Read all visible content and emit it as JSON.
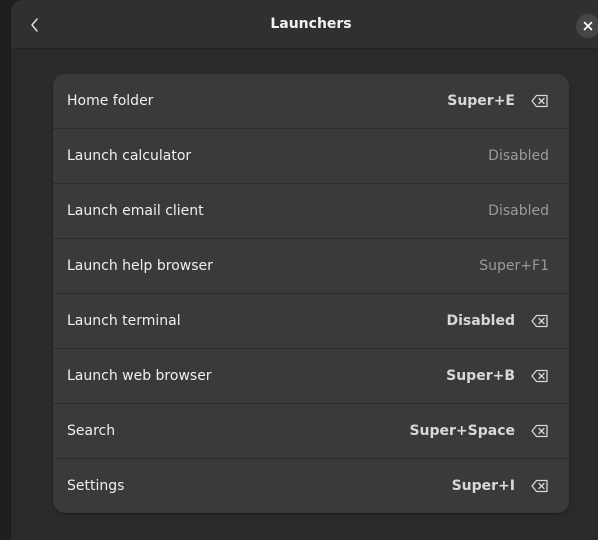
{
  "header": {
    "title": "Launchers",
    "back_icon": "chevron-left-icon",
    "close_icon": "close-icon"
  },
  "shortcuts": [
    {
      "label": "Home folder",
      "accel": "Super+E",
      "custom": true
    },
    {
      "label": "Launch calculator",
      "accel": "Disabled",
      "custom": false
    },
    {
      "label": "Launch email client",
      "accel": "Disabled",
      "custom": false
    },
    {
      "label": "Launch help browser",
      "accel": "Super+F1",
      "custom": false
    },
    {
      "label": "Launch terminal",
      "accel": "Disabled",
      "custom": true
    },
    {
      "label": "Launch web browser",
      "accel": "Super+B",
      "custom": true
    },
    {
      "label": "Search",
      "accel": "Super+Space",
      "custom": true
    },
    {
      "label": "Settings",
      "accel": "Super+I",
      "custom": true
    }
  ],
  "colors": {
    "window_bg": "#2d2d2d",
    "list_bg": "#3a3a3a",
    "text_primary": "#f0f0f0",
    "text_dim": "#9a9a9a"
  }
}
